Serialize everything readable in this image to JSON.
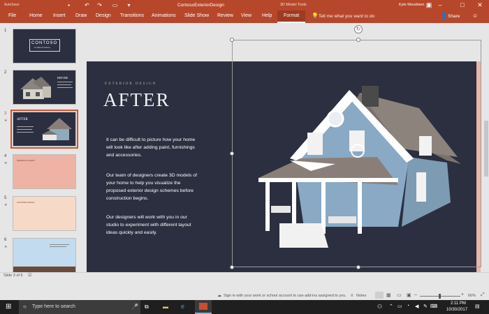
{
  "titlebar": {
    "autosave_label": "AutoSave",
    "file_title": "ContosoExteriorDesign",
    "context_tools": "3D Model Tools",
    "user": "Kyle Mourtisen",
    "brand_color": "#b7472a"
  },
  "ribbon": {
    "tabs": [
      "File",
      "Home",
      "Insert",
      "Draw",
      "Design",
      "Transitions",
      "Animations",
      "Slide Show",
      "Review",
      "View",
      "Help",
      "Format"
    ],
    "tell_me": "Tell me what you want to do",
    "share": "Share"
  },
  "thumbnails": {
    "numbers": [
      "1",
      "2",
      "3",
      "4",
      "5",
      "6"
    ],
    "slide1_title": "CONTOSO",
    "slide1_sub": "EXTERIOR DESIGN",
    "slide2_title": "BEFORE",
    "slide3_title": "AFTER",
    "slide4_title": "SHADING & PAINT",
    "slide5_title": "CUSTOM & BUILD"
  },
  "slide": {
    "eyebrow": "EXTERIOR DESIGN",
    "title": "AFTER",
    "paragraphs": [
      "It can be difficult to picture how your home will look like after adding paint, furnishings and accessories.",
      "Our team of designers create 3D models of your home to help you visualize the proposed exterior design schemes before construction begins.",
      "Our designers will work with you in our studio to experiment with different layout ideas quickly and easily."
    ]
  },
  "statusbar": {
    "slide_of": "Slide 3 of 6",
    "signin": "Sign in with your work or school account to use add-ins assigned to you.",
    "notes": "Notes",
    "zoom": "66%"
  },
  "taskbar": {
    "search_placeholder": "Type here to search",
    "time": "2:11 PM",
    "date": "10/30/2017"
  }
}
